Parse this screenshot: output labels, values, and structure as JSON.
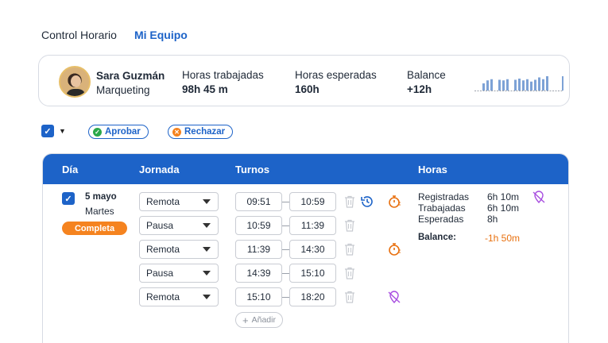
{
  "tabs": [
    {
      "label": "Control Horario",
      "active": true
    },
    {
      "label": "Mi Equipo",
      "active": false
    }
  ],
  "user": {
    "name": "Sara Guzmán",
    "department": "Marqueting"
  },
  "stats": {
    "worked_label": "Horas trabajadas",
    "worked_value": "98h 45 m",
    "expected_label": "Horas esperadas",
    "expected_value": "160h",
    "balance_label": "Balance",
    "balance_value": "+12h"
  },
  "sparkline": {
    "values": [
      0.6,
      0.85,
      0.95,
      0,
      0.9,
      0.85,
      0.95,
      0,
      0.9,
      1.0,
      0.85,
      0.95,
      0.75,
      0.9,
      1.1,
      0.95,
      1.2,
      0,
      0,
      0,
      1.2,
      0
    ],
    "color": "#7da2d6",
    "baseline_color": "#9aa0aa"
  },
  "actions": {
    "approve_label": "Aprobar",
    "reject_label": "Rechazar",
    "approve_color": "#2aa84a",
    "reject_color": "#f5831f"
  },
  "table": {
    "headers": {
      "day": "Día",
      "shift": "Jornada",
      "turns": "Turnos",
      "hours": "Horas"
    },
    "header_color": "#1d63c8"
  },
  "day": {
    "date": "5 mayo",
    "weekday": "Martes",
    "status": "Completa",
    "status_color": "#f5831f"
  },
  "turns": [
    {
      "type": "Remota",
      "start": "09:51",
      "end": "10:59",
      "icons": [
        "history-icon",
        "stopwatch-icon"
      ]
    },
    {
      "type": "Pausa",
      "start": "10:59",
      "end": "11:39",
      "icons": []
    },
    {
      "type": "Remota",
      "start": "11:39",
      "end": "14:30",
      "icons": [
        "stopwatch-icon"
      ]
    },
    {
      "type": "Pausa",
      "start": "14:39",
      "end": "15:10",
      "icons": []
    },
    {
      "type": "Remota",
      "start": "15:10",
      "end": "18:20",
      "icons": [
        "location-off-icon"
      ]
    }
  ],
  "add_label": "Añadir",
  "hours": {
    "registered_label": "Registradas",
    "registered_value": "6h 10m",
    "worked_label": "Trabajadas",
    "worked_value": "6h 10m",
    "expected_label": "Esperadas",
    "expected_value": "8h",
    "balance_label": "Balance:",
    "balance_value": "-1h 50m"
  }
}
